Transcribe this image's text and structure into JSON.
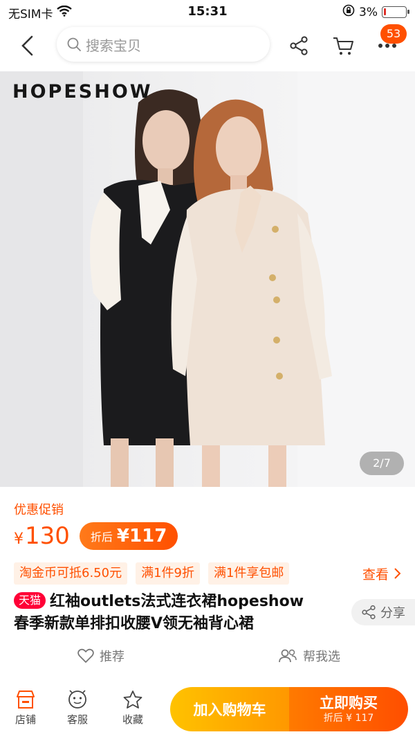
{
  "status_bar": {
    "carrier": "无SIM卡",
    "time": "15:31",
    "battery": "3%"
  },
  "nav": {
    "search_placeholder": "搜索宝贝",
    "cart_badge": "53"
  },
  "gallery": {
    "brand": "HOPESHOW",
    "page_indicator": "2/7"
  },
  "price": {
    "promo_label": "优惠促销",
    "currency": "¥",
    "value": "130",
    "discount_label": "折后",
    "discount_value": "¥117"
  },
  "coupons": {
    "items": [
      "淘金币可抵6.50元",
      "满1件9折",
      "满1件享包邮"
    ],
    "see_more": "查看"
  },
  "product": {
    "tag": "天猫",
    "title_line1": "红袖outlets法式连衣裙hopeshow",
    "title_line2": "春季新款单排扣收腰V领无袖背心裙",
    "share": "分享"
  },
  "sub_actions": {
    "recommend": "推荐",
    "help_choose": "帮我选"
  },
  "bottom_bar": {
    "tabs": [
      "店铺",
      "客服",
      "收藏"
    ],
    "add_to_cart": "加入购物车",
    "buy_now": "立即购买",
    "buy_now_sub": "折后 ¥ 117"
  },
  "colors": {
    "accent": "#ff5000",
    "tmall": "#ff0036"
  }
}
